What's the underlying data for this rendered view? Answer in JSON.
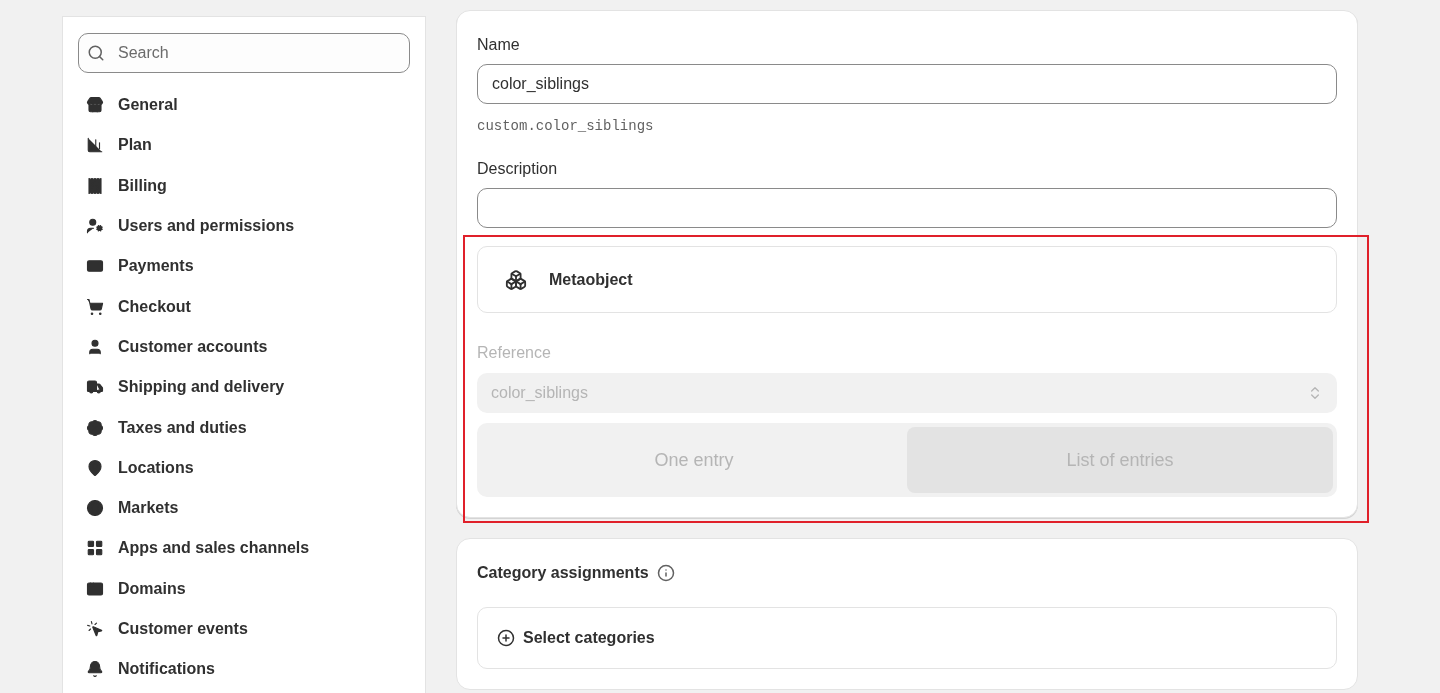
{
  "sidebar": {
    "search": {
      "placeholder": "Search"
    },
    "items": [
      {
        "label": "General"
      },
      {
        "label": "Plan"
      },
      {
        "label": "Billing"
      },
      {
        "label": "Users and permissions"
      },
      {
        "label": "Payments"
      },
      {
        "label": "Checkout"
      },
      {
        "label": "Customer accounts"
      },
      {
        "label": "Shipping and delivery"
      },
      {
        "label": "Taxes and duties"
      },
      {
        "label": "Locations"
      },
      {
        "label": "Markets"
      },
      {
        "label": "Apps and sales channels"
      },
      {
        "label": "Domains"
      },
      {
        "label": "Customer events"
      },
      {
        "label": "Notifications"
      }
    ]
  },
  "definition": {
    "name": {
      "label": "Name",
      "value": "color_siblings"
    },
    "namespace_key": "custom.color_siblings",
    "description": {
      "label": "Description"
    },
    "type": {
      "label": "Metaobject"
    },
    "reference": {
      "label": "Reference",
      "value": "color_siblings",
      "disabled": true
    },
    "cardinality": [
      {
        "label": "One entry",
        "selected": false
      },
      {
        "label": "List of entries",
        "selected": true
      }
    ]
  },
  "category_assignments": {
    "title": "Category assignments",
    "button": "Select categories"
  }
}
